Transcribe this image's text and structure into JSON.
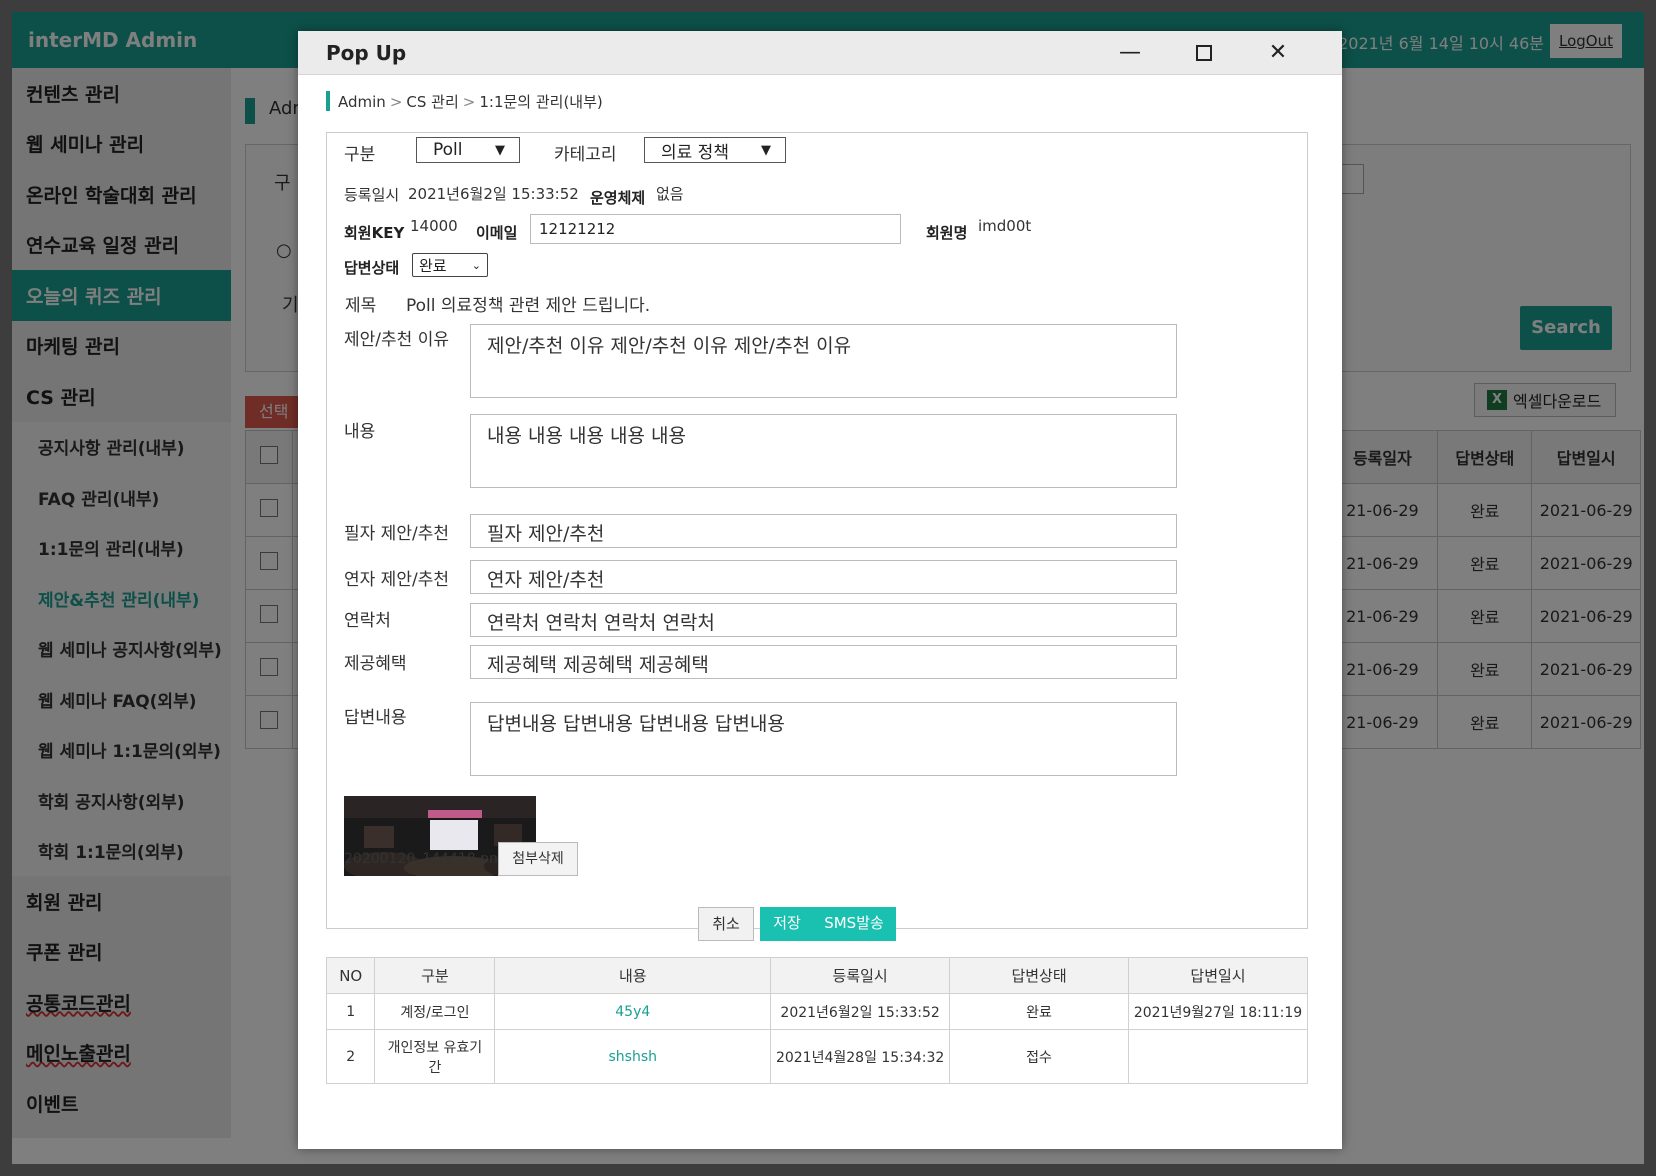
{
  "background": {
    "brand": "interMD Admin",
    "datetime": "2021년 6월 14일 10시 46분",
    "logout": "LogOut",
    "sidebar": {
      "main_top": [
        "컨텐츠 관리",
        "웹 세미나 관리",
        "온라인 학술대회 관리",
        "연수교육 일정 관리"
      ],
      "active": "오늘의 퀴즈 관리",
      "main_mid": [
        "마케팅 관리",
        "CS 관리"
      ],
      "sub": [
        "공지사항 관리(내부)",
        "FAQ 관리(내부)",
        "1:1문의 관리(내부)"
      ],
      "sub_current": "제안&추천 관리(내부)",
      "sub_rest": [
        "웹 세미나 공지사항(외부)",
        "웹 세미나 FAQ(외부)",
        "웹 세미나 1:1문의(외부)",
        "학회 공지사항(외부)",
        "학회 1:1문의(외부)"
      ],
      "main_bottom": [
        "회원 관리",
        "쿠폰 관리"
      ],
      "main_bottom_ul": [
        "공통코드관리",
        "메인노출관리"
      ],
      "last": "이벤트"
    },
    "breadcrumb_fragment": "Adm",
    "search_label_fragment": "구",
    "period_fragment": "기",
    "search_button": "Search",
    "delete_selected_fragment": "선택",
    "excel_download": "엑셀다운로드",
    "excel_icon_letter": "X",
    "table_headers": [
      "등록일자",
      "답변상태",
      "답변일시"
    ],
    "table_rows": [
      {
        "date": "21-06-29",
        "status": "완료",
        "answered": "2021-06-29"
      },
      {
        "date": "21-06-29",
        "status": "완료",
        "answered": "2021-06-29"
      },
      {
        "date": "21-06-29",
        "status": "완료",
        "answered": "2021-06-29"
      },
      {
        "date": "21-06-29",
        "status": "완료",
        "answered": "2021-06-29"
      },
      {
        "date": "21-06-29",
        "status": "완료",
        "answered": "2021-06-29"
      }
    ]
  },
  "modal": {
    "title": "Pop Up",
    "window_controls": {
      "minimize": "—",
      "close": "✕"
    },
    "breadcrumb": [
      "Admin",
      "CS 관리",
      "1:1문의 관리(내부)"
    ],
    "breadcrumb_sep": ">",
    "form": {
      "category_type_label": "구분",
      "category_type_value": "Poll",
      "category_label": "카테고리",
      "category_value": "의료 정책",
      "registered_label": "등록일시",
      "registered_value": "2021년6월2일 15:33:52",
      "os_label": "운영체제",
      "os_value": "없음",
      "member_key_label": "회원KEY",
      "member_key_value": "14000",
      "email_label": "이메일",
      "email_value": "12121212",
      "member_name_label": "회원명",
      "member_name_value": "imd00t",
      "answer_status_label": "답변상태",
      "answer_status_value": "완료",
      "subject_label": "제목",
      "subject_value": "Poll 의료정책 관련 제안 드립니다.",
      "reason_label": "제안/추천 이유",
      "reason_value": "제안/추천 이유 제안/추천 이유 제안/추천 이유",
      "content_label": "내용",
      "content_value": "내용 내용 내용 내용 내용",
      "writer_label": "필자 제안/추천",
      "writer_value": "필자 제안/추천",
      "speaker_label": "연자 제안/추천",
      "speaker_value": "연자 제안/추천",
      "contact_label": "연락처",
      "contact_value": "연락처 연락처 연락처 연락처",
      "benefit_label": "제공혜택",
      "benefit_value": "제공혜택 제공혜택 제공혜택",
      "answer_label": "답변내용",
      "answer_value": "답변내용 답변내용 답변내용 답변내용",
      "attachment_name": "20200120_144418.png",
      "attachment_delete": "첨부삭제"
    },
    "buttons": {
      "cancel": "취소",
      "save": "저장",
      "sms": "SMS발송"
    },
    "history": {
      "headers": [
        "NO",
        "구분",
        "내용",
        "등록일시",
        "답변상태",
        "답변일시"
      ],
      "rows": [
        {
          "no": "1",
          "type": "계정/로그인",
          "content": "45y4",
          "registered": "2021년6월2일 15:33:52",
          "status": "완료",
          "answered": "2021년9월27일 18:11:19"
        },
        {
          "no": "2",
          "type": "개인정보 유효기간",
          "content": "shshsh",
          "registered": "2021년4월28일 15:34:32",
          "status": "접수",
          "answered": ""
        }
      ]
    }
  }
}
